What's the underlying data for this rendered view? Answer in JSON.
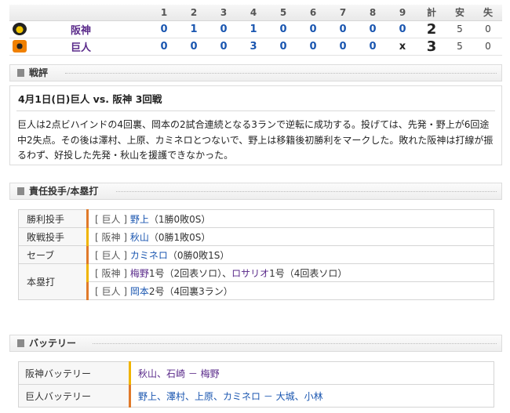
{
  "scoreboard": {
    "headers": [
      "1",
      "2",
      "3",
      "4",
      "5",
      "6",
      "7",
      "8",
      "9",
      "計",
      "安",
      "失"
    ],
    "teams": [
      {
        "name": "阪神",
        "logo": "tigers-logo-icon",
        "innings": [
          "0",
          "1",
          "0",
          "1",
          "0",
          "0",
          "0",
          "0",
          "0"
        ],
        "runs": "2",
        "hits": "5",
        "errors": "0"
      },
      {
        "name": "巨人",
        "logo": "giants-logo-icon",
        "innings": [
          "0",
          "0",
          "0",
          "3",
          "0",
          "0",
          "0",
          "0",
          "x"
        ],
        "runs": "3",
        "hits": "5",
        "errors": "0"
      }
    ]
  },
  "review": {
    "header": "戦評",
    "game_title": "4月1日(日)巨人 vs. 阪神 3回戦",
    "text": "巨人は2点ビハインドの4回裏、岡本の2試合連続となる3ランで逆転に成功する。投げては、先発・野上が6回途中2失点。その後は澤村、上原、カミネロとつないで、野上は移籍後初勝利をマークした。敗れた阪神は打線が振るわず、好投した先発・秋山を援護できなかった。"
  },
  "pitchers_section": {
    "header": "責任投手/本塁打",
    "win": {
      "label": "勝利投手",
      "team": "巨人",
      "name": "野上",
      "detail": "（1勝0敗0S）"
    },
    "loss": {
      "label": "敗戦投手",
      "team": "阪神",
      "name": "秋山",
      "detail": "（0勝1敗0S）"
    },
    "save": {
      "label": "セーブ",
      "team": "巨人",
      "name": "カミネロ",
      "detail": "（0勝0敗1S）"
    },
    "homeruns": {
      "label": "本塁打",
      "rows": [
        {
          "team": "阪神",
          "entries": [
            {
              "name": "梅野",
              "detail": "1号（2回表ソロ）"
            },
            {
              "name": "ロサリオ",
              "detail": "1号（4回表ソロ）"
            }
          ]
        },
        {
          "team": "巨人",
          "entries": [
            {
              "name": "岡本",
              "detail": "2号（4回裏3ラン）"
            }
          ]
        }
      ]
    }
  },
  "battery_section": {
    "header": "バッテリー",
    "rows": [
      {
        "label": "阪神バッテリー",
        "text": "秋山、石崎 － 梅野"
      },
      {
        "label": "巨人バッテリー",
        "text": "野上、澤村、上原、カミネロ － 大城、小林"
      }
    ]
  },
  "colors": {
    "link_blue": "#1a56b0",
    "team_purple": "#5a2a8a",
    "accent_orange": "#e07a2a",
    "accent_gold": "#f0b400"
  }
}
